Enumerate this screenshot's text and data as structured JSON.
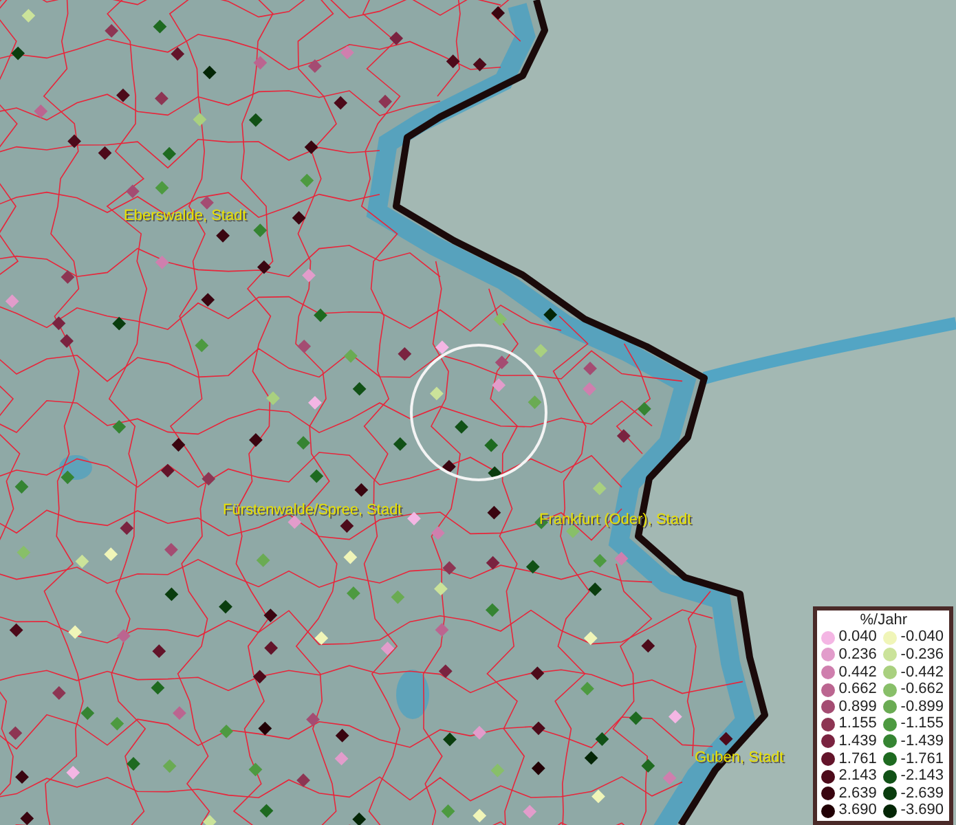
{
  "map": {
    "place_labels": [
      "Eberswalde, Stadt",
      "Fürstenwalde/Spree, Stadt",
      "Frankfurt (Oder), Stadt",
      "Guben, Stadt"
    ]
  },
  "legend": {
    "title": "%/Jahr",
    "rows": [
      {
        "positive": {
          "label": "0.040",
          "color": "#f4b6e4"
        },
        "negative": {
          "label": "-0.040",
          "color": "#f0f5b8"
        }
      },
      {
        "positive": {
          "label": "0.236",
          "color": "#e29ccb"
        },
        "negative": {
          "label": "-0.236",
          "color": "#cbe39a"
        }
      },
      {
        "positive": {
          "label": "0.442",
          "color": "#cf7fae"
        },
        "negative": {
          "label": "-0.442",
          "color": "#a9d07f"
        }
      },
      {
        "positive": {
          "label": "0.662",
          "color": "#bb6590"
        },
        "negative": {
          "label": "-0.662",
          "color": "#88bf69"
        }
      },
      {
        "positive": {
          "label": "0.899",
          "color": "#a44c72"
        },
        "negative": {
          "label": "-0.899",
          "color": "#6aab53"
        }
      },
      {
        "positive": {
          "label": "1.155",
          "color": "#8d3553"
        },
        "negative": {
          "label": "-1.155",
          "color": "#4d9a40"
        }
      },
      {
        "positive": {
          "label": "1.439",
          "color": "#7a2340"
        },
        "negative": {
          "label": "-1.439",
          "color": "#358432"
        }
      },
      {
        "positive": {
          "label": "1.761",
          "color": "#63142a"
        },
        "negative": {
          "label": "-1.761",
          "color": "#1e6a20"
        }
      },
      {
        "positive": {
          "label": "2.143",
          "color": "#4d0a1a"
        },
        "negative": {
          "label": "-2.143",
          "color": "#115116"
        }
      },
      {
        "positive": {
          "label": "2.639",
          "color": "#3a0510"
        },
        "negative": {
          "label": "-2.639",
          "color": "#0a3d0e"
        }
      },
      {
        "positive": {
          "label": "3.690",
          "color": "#220005"
        },
        "negative": {
          "label": "-3.690",
          "color": "#042606"
        }
      }
    ]
  }
}
